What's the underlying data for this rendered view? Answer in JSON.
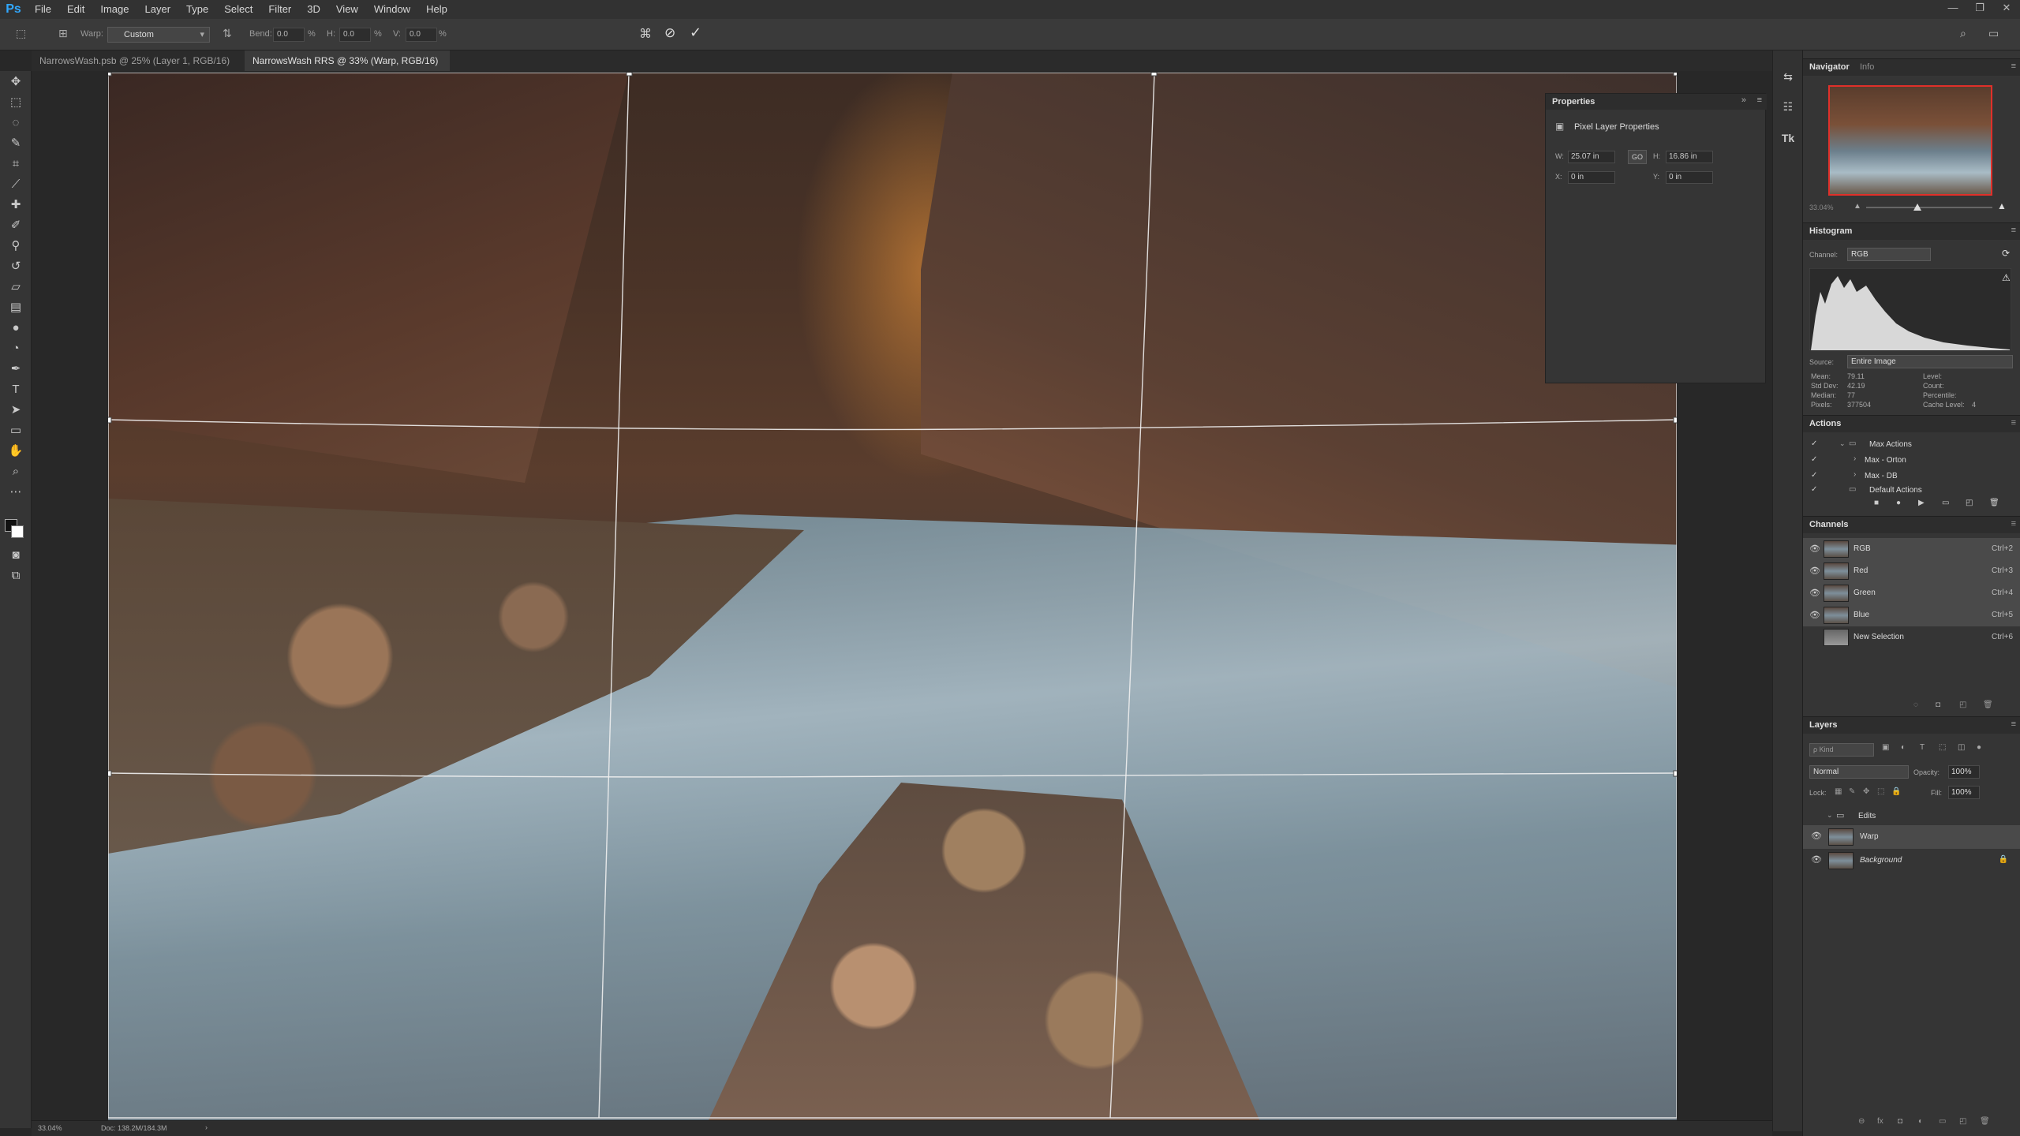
{
  "menubar": {
    "logo": "Ps",
    "items": [
      "File",
      "Edit",
      "Image",
      "Layer",
      "Type",
      "Select",
      "Filter",
      "3D",
      "View",
      "Window",
      "Help"
    ],
    "window_controls": [
      "—",
      "❐",
      "✕"
    ]
  },
  "options": {
    "warp_label": "Warp:",
    "warp_value": "Custom",
    "bend_label": "Bend:",
    "bend_value": "0.0",
    "bend_unit": "%",
    "h_label": "H:",
    "h_value": "0.0",
    "h_unit": "%",
    "v_label": "V:",
    "v_value": "0.0",
    "v_unit": "%"
  },
  "tabs": [
    {
      "label": "NarrowsWash.psb @ 25% (Layer 1, RGB/16) *",
      "close": "×"
    },
    {
      "label": "NarrowsWash RRS @ 33% (Warp, RGB/16) *",
      "close": "×"
    }
  ],
  "properties": {
    "title": "Properties",
    "subtitle": "Pixel Layer Properties",
    "w_label": "W:",
    "w_value": "25.07 in",
    "h_label": "H:",
    "h_value": "16.86 in",
    "link": "GO",
    "x_label": "X:",
    "x_value": "0 in",
    "y_label": "Y:",
    "y_value": "0 in"
  },
  "navigator": {
    "title": "Navigator",
    "info_tab": "Info",
    "zoom": "33.04%"
  },
  "histogram": {
    "title": "Histogram",
    "channel_label": "Channel:",
    "channel_value": "RGB",
    "source_label": "Source:",
    "source_value": "Entire Image",
    "stats": [
      {
        "label": "Mean:",
        "value": "79.11"
      },
      {
        "label": "Std Dev:",
        "value": "42.19"
      },
      {
        "label": "Median:",
        "value": "77"
      },
      {
        "label": "Pixels:",
        "value": "377504"
      }
    ],
    "stats_right": [
      {
        "label": "Level:",
        "value": ""
      },
      {
        "label": "Count:",
        "value": ""
      },
      {
        "label": "Percentile:",
        "value": ""
      },
      {
        "label": "Cache Level:",
        "value": "4"
      }
    ]
  },
  "actions": {
    "title": "Actions",
    "items": [
      {
        "label": "Max Actions",
        "type": "folder"
      },
      {
        "label": "Max - Orton",
        "type": "action"
      },
      {
        "label": "Max - DB",
        "type": "action"
      },
      {
        "label": "Default Actions",
        "type": "folder"
      }
    ]
  },
  "channels": {
    "title": "Channels",
    "items": [
      {
        "label": "RGB",
        "shortcut": "Ctrl+2"
      },
      {
        "label": "Red",
        "shortcut": "Ctrl+3"
      },
      {
        "label": "Green",
        "shortcut": "Ctrl+4"
      },
      {
        "label": "Blue",
        "shortcut": "Ctrl+5"
      },
      {
        "label": "New Selection",
        "shortcut": "Ctrl+6"
      }
    ]
  },
  "layers": {
    "title": "Layers",
    "kind_placeholder": "ρ Kind",
    "blend_mode": "Normal",
    "opacity_label": "Opacity:",
    "opacity_value": "100%",
    "lock_label": "Lock:",
    "fill_label": "Fill:",
    "fill_value": "100%",
    "items": [
      {
        "label": "Edits",
        "type": "group"
      },
      {
        "label": "Warp",
        "type": "layer",
        "selected": true
      },
      {
        "label": "Background",
        "type": "layer",
        "locked": true
      }
    ]
  },
  "status": {
    "zoom": "33.04%",
    "doc": "Doc: 138.2M/184.3M",
    "arrow": "›"
  }
}
